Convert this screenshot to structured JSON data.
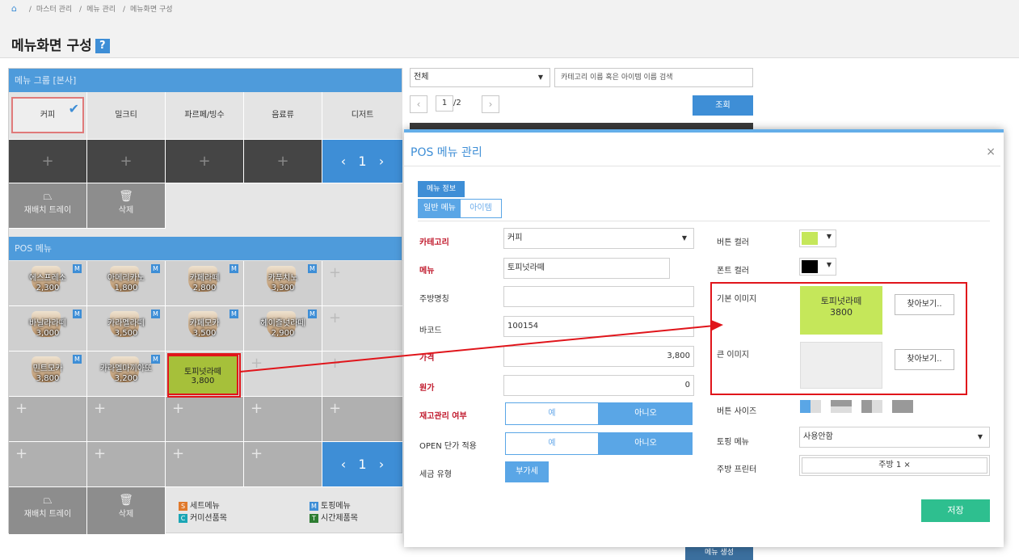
{
  "breadcrumb": {
    "items": [
      "마스터 관리",
      "메뉴 관리",
      "메뉴화면 구성"
    ]
  },
  "page_title": "메뉴화면 구성",
  "help_label": "?",
  "menu_group": {
    "header": "메뉴 그룹 [본사]",
    "categories": [
      "커피",
      "밀크티",
      "파르페/빙수",
      "음료류",
      "디저트"
    ],
    "add_label": "+",
    "page": "1",
    "tray_label": "재배치 트레이",
    "delete_label": "삭제"
  },
  "pos_menu": {
    "header": "POS 메뉴",
    "rows": [
      [
        {
          "name": "에스프레소",
          "price": "2,300",
          "badge": "M"
        },
        {
          "name": "아메리카노",
          "price": "1,800",
          "badge": "M"
        },
        {
          "name": "카페라떼",
          "price": "2,800",
          "badge": "M"
        },
        {
          "name": "카푸치노",
          "price": "3,300",
          "badge": "M"
        }
      ],
      [
        {
          "name": "바닐라라떼",
          "price": "3,000",
          "badge": "M"
        },
        {
          "name": "카라멜라떼",
          "price": "3,500",
          "badge": "M"
        },
        {
          "name": "카페모카",
          "price": "3,500",
          "badge": "M"
        },
        {
          "name": "헤이즐넛라떼",
          "price": "2,900",
          "badge": "M"
        }
      ],
      [
        {
          "name": "민트모카",
          "price": "3,800",
          "badge": "M"
        },
        {
          "name": "카라멜마끼아또",
          "price": "3,200",
          "badge": "M"
        },
        {
          "name": "토피넛라떼",
          "price": "3,800",
          "badge": ""
        }
      ]
    ],
    "page": "1",
    "add_label": "+"
  },
  "legend": [
    {
      "badge": "S",
      "label": "세트메뉴",
      "color": "#e0792b"
    },
    {
      "badge": "M",
      "label": "토핑메뉴",
      "color": "#3e8ed6"
    },
    {
      "badge": "C",
      "label": "커미션품목",
      "color": "#1aa6b5"
    },
    {
      "badge": "T",
      "label": "시간제품목",
      "color": "#2e7d32"
    }
  ],
  "search": {
    "select_value": "전체",
    "placeholder": "카테고리 이름 혹은 아이템 이름 검색",
    "page": "1",
    "page_total": "/2",
    "query_label": "조회"
  },
  "bottom_hidden_btn": "메뉴 생성",
  "modal": {
    "title": "POS 메뉴 관리",
    "close": "×",
    "section_tab": "메뉴 정보",
    "tabs": [
      "일반 메뉴",
      "아이템"
    ],
    "fields": {
      "category": {
        "label": "카테고리",
        "value": "커피"
      },
      "menu": {
        "label": "메뉴",
        "value": "토피넛라떼"
      },
      "kitchen_name": {
        "label": "주방명칭",
        "value": ""
      },
      "barcode": {
        "label": "바코드",
        "value": "100154"
      },
      "price": {
        "label": "가격",
        "value": "3,800"
      },
      "cost": {
        "label": "원가",
        "value": "0"
      },
      "stock": {
        "label": "재고관리 여부",
        "yes": "예",
        "no": "아니오"
      },
      "open_price": {
        "label": "OPEN 단가 적용",
        "yes": "예",
        "no": "아니오"
      },
      "tax": {
        "label": "세금 유형",
        "value": "부가세"
      },
      "button_color": {
        "label": "버튼 컬러",
        "color": "#c5e75a"
      },
      "font_color": {
        "label": "폰트 컬러",
        "color": "#000000"
      },
      "basic_image": {
        "label": "기본 이미지",
        "name": "토피넛라떼",
        "price": "3800",
        "button": "찾아보기.."
      },
      "large_image": {
        "label": "큰 이미지",
        "button": "찾아보기.."
      },
      "button_size": {
        "label": "버튼 사이즈"
      },
      "topping_menu": {
        "label": "토핑 메뉴",
        "value": "사용안함"
      },
      "kitchen_printer": {
        "label": "주방 프린터",
        "value": "주방 1 ×"
      }
    },
    "save_label": "저장"
  },
  "colors": {
    "accent": "#3e8ed6",
    "highlight_red": "#e0151b",
    "selected_green": "#c5e75a",
    "save_green": "#2ebf8f"
  }
}
